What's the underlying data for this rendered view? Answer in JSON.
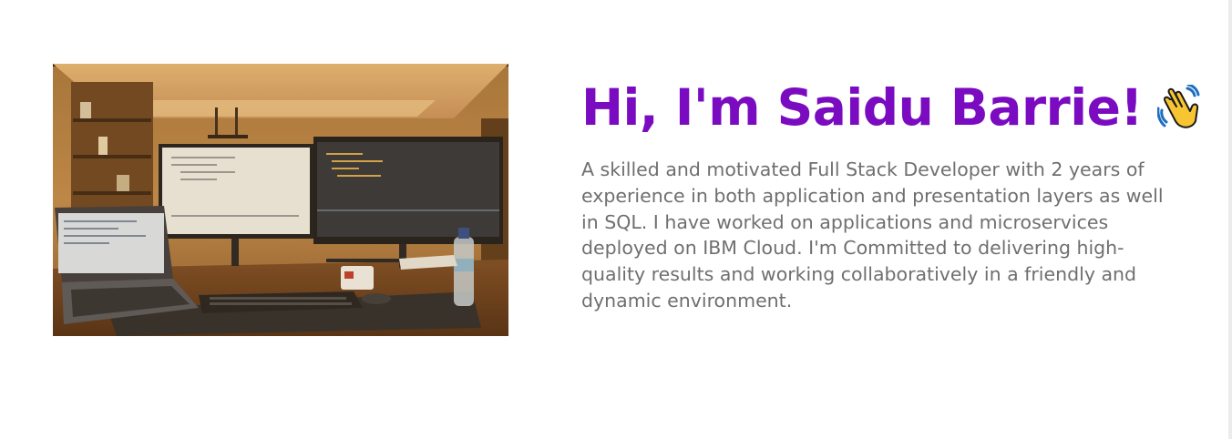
{
  "hero": {
    "heading": "Hi, I'm Saidu Barrie!",
    "wave_icon": "waving-hand-emoji",
    "bio": "A skilled and motivated Full Stack Developer with 2 years of experience in both application and presentation layers as well in SQL. I have worked on applications and microservices deployed on IBM Cloud. I'm Committed to delivering high-quality results and working collaboratively in a friendly and dynamic environment.",
    "photo_icon": "desk-setup-photo"
  },
  "colors": {
    "heading": "#7a0bc0",
    "bio_text": "#6f6f6f",
    "background": "#ffffff"
  }
}
